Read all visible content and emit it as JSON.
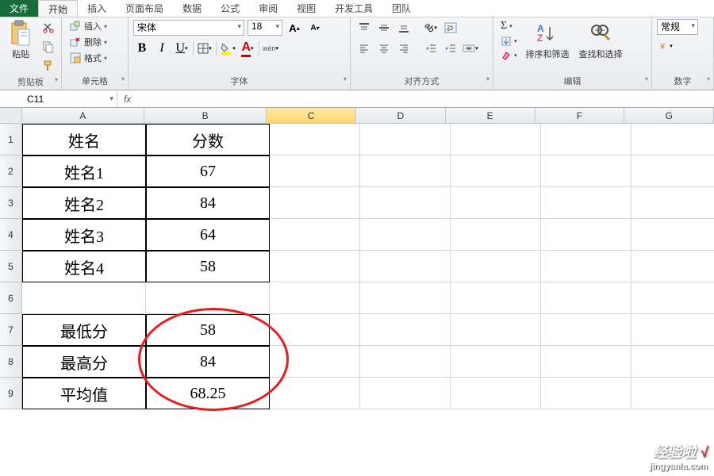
{
  "tabs": {
    "file": "文件",
    "start": "开始",
    "insert": "插入",
    "layout": "页面布局",
    "data": "数据",
    "formula": "公式",
    "review": "审阅",
    "view": "视图",
    "dev": "开发工具",
    "team": "团队"
  },
  "clipboard": {
    "paste": "粘贴",
    "label": "剪贴板"
  },
  "cells": {
    "insert": "插入",
    "delete": "删除",
    "format": "格式",
    "label": "单元格"
  },
  "font": {
    "name": "宋体",
    "size": "18",
    "label": "字体"
  },
  "align": {
    "label": "对齐方式"
  },
  "edit": {
    "sort": "排序和筛选",
    "find": "查找和选择",
    "label": "编辑"
  },
  "number": {
    "format": "常规",
    "label": "数字"
  },
  "formula_bar": {
    "cell": "C11",
    "fx": "fx"
  },
  "columns": [
    "A",
    "B",
    "C",
    "D",
    "E",
    "F",
    "G"
  ],
  "rows": [
    "1",
    "2",
    "3",
    "4",
    "5",
    "6",
    "7",
    "8",
    "9"
  ],
  "sheet": {
    "a1": "姓名",
    "b1": "分数",
    "a2": "姓名1",
    "b2": "67",
    "a3": "姓名2",
    "b3": "84",
    "a4": "姓名3",
    "b4": "64",
    "a5": "姓名4",
    "b5": "58",
    "a7": "最低分",
    "b7": "58",
    "a8": "最高分",
    "b8": "84",
    "a9": "平均值",
    "b9": "68.25"
  },
  "watermark": {
    "brand": "经验啦",
    "check": "√",
    "url": "jingyanla.com"
  }
}
